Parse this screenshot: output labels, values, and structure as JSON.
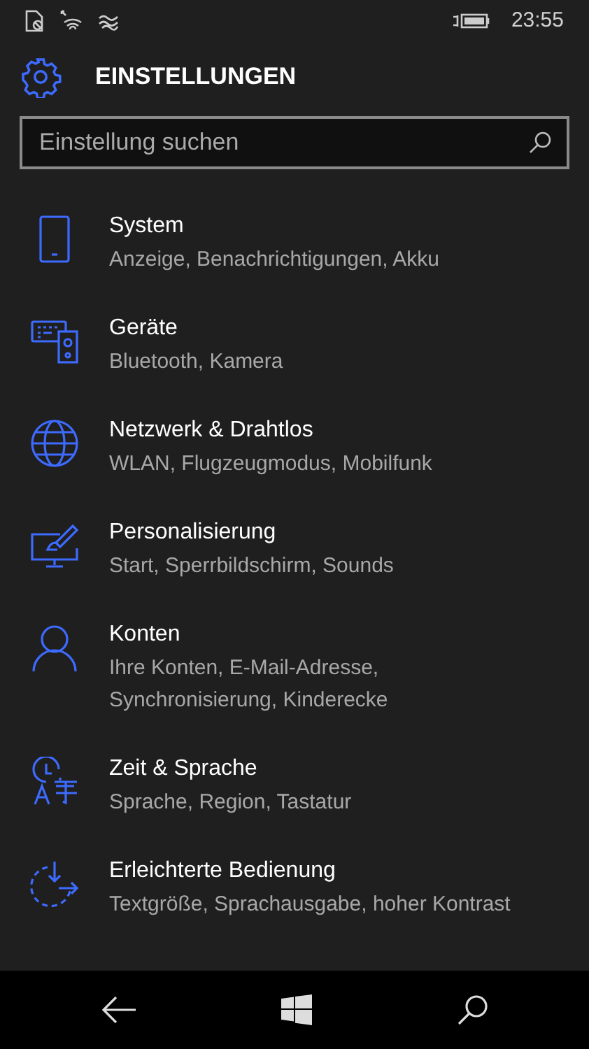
{
  "status_bar": {
    "time": "23:55"
  },
  "header": {
    "title": "EINSTELLUNGEN"
  },
  "search": {
    "placeholder": "Einstellung suchen"
  },
  "categories": [
    {
      "title": "System",
      "subtitle": "Anzeige, Benachrichtigungen, Akku"
    },
    {
      "title": "Geräte",
      "subtitle": "Bluetooth, Kamera"
    },
    {
      "title": "Netzwerk & Drahtlos",
      "subtitle": "WLAN, Flugzeugmodus, Mobilfunk"
    },
    {
      "title": "Personalisierung",
      "subtitle": "Start, Sperrbildschirm, Sounds"
    },
    {
      "title": "Konten",
      "subtitle": "Ihre Konten, E-Mail-Adresse, Synchronisierung, Kinderecke"
    },
    {
      "title": "Zeit & Sprache",
      "subtitle": "Sprache, Region, Tastatur"
    },
    {
      "title": "Erleichterte Bedienung",
      "subtitle": "Textgröße, Sprachausgabe, hoher Kontrast"
    }
  ]
}
